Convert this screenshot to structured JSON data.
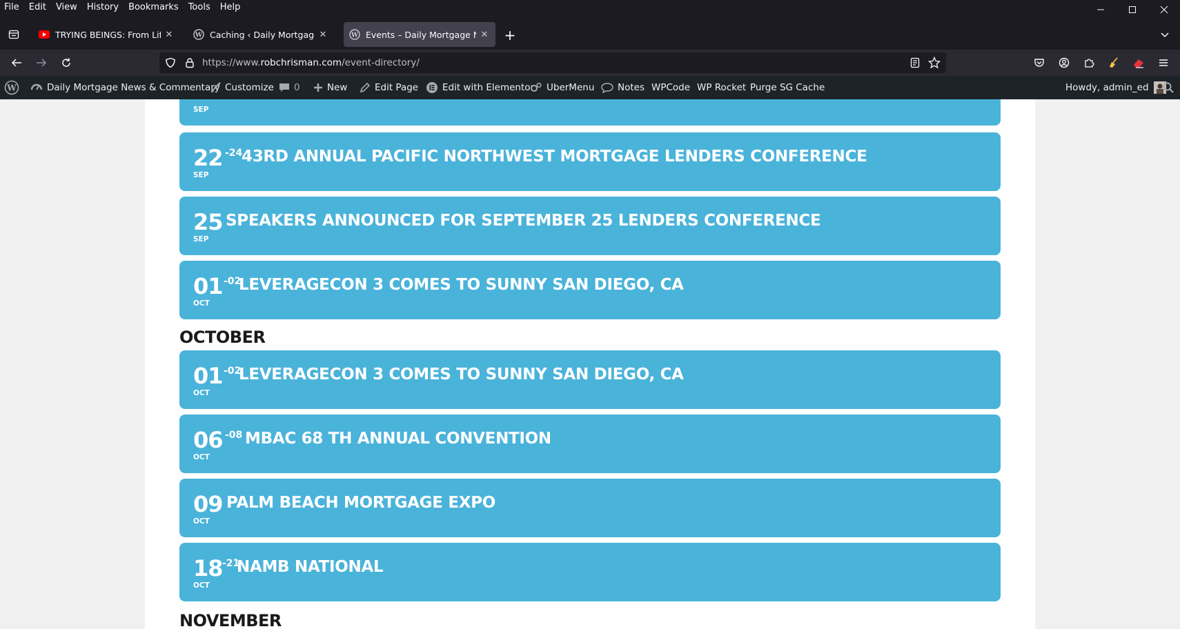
{
  "menubar": {
    "items": [
      "File",
      "Edit",
      "View",
      "History",
      "Bookmarks",
      "Tools",
      "Help"
    ]
  },
  "tabs": [
    {
      "title": "TRYING BEINGS: From Life's Ori",
      "favicon": "youtube-icon"
    },
    {
      "title": "Caching ‹ Daily Mortgage News",
      "favicon": "wordpress-icon"
    },
    {
      "title": "Events – Daily Mortgage News &",
      "favicon": "wordpress-icon",
      "active": true
    }
  ],
  "url": {
    "prefix": "https://www.",
    "domain": "robchrisman.com",
    "path": "/event-directory/"
  },
  "adminbar": {
    "site_name": "Daily Mortgage News & Commentary",
    "customize": "Customize",
    "comments_count": "0",
    "new": "New",
    "edit_page": "Edit Page",
    "elementor": "Edit with Elementor",
    "ubermenu": "UberMenu",
    "notes": "Notes",
    "wpcode": "WPCode",
    "wprocket": "WP Rocket",
    "purge": "Purge SG Cache",
    "howdy": "Howdy, admin_ed"
  },
  "events_top": [
    {
      "day": "",
      "range": "",
      "month": "SEP",
      "title": ""
    },
    {
      "day": "22",
      "range": "-24",
      "month": "SEP",
      "title": "43RD ANNUAL PACIFIC NORTHWEST MORTGAGE LENDERS CONFERENCE"
    },
    {
      "day": "25",
      "range": "",
      "month": "SEP",
      "title": "SPEAKERS ANNOUNCED FOR SEPTEMBER 25 LENDERS CONFERENCE"
    },
    {
      "day": "01",
      "range": "-02",
      "month": "OCT",
      "title": "LEVERAGECON 3 COMES TO SUNNY SAN DIEGO, CA"
    }
  ],
  "october_heading": "OCTOBER",
  "events_october": [
    {
      "day": "01",
      "range": "-02",
      "month": "OCT",
      "title": "LEVERAGECON 3 COMES TO SUNNY SAN DIEGO, CA"
    },
    {
      "day": "06",
      "range": "-08",
      "month": "OCT",
      "title": "MBAC 68 TH ANNUAL CONVENTION"
    },
    {
      "day": "09",
      "range": "",
      "month": "OCT",
      "title": "PALM BEACH MORTGAGE EXPO"
    },
    {
      "day": "18",
      "range": "-21",
      "month": "OCT",
      "title": "NAMB NATIONAL"
    }
  ],
  "november_heading": "NOVEMBER",
  "colors": {
    "event_bg": "#4ab3da",
    "admin_bg": "#1d2327",
    "chrome_bg": "#1c1b22",
    "toolbar_bg": "#2b2a33"
  }
}
